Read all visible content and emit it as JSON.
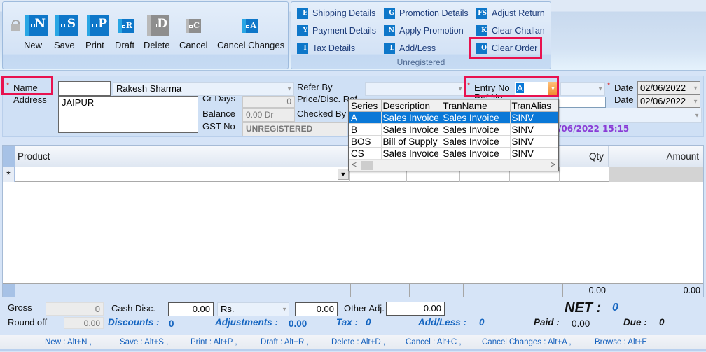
{
  "toolbar": {
    "main_buttons": [
      {
        "label": "New",
        "glyph": "N",
        "enabled": true
      },
      {
        "label": "Save",
        "glyph": "S",
        "enabled": true
      },
      {
        "label": "Print",
        "glyph": "P",
        "enabled": true
      },
      {
        "label": "Draft",
        "glyph": "R",
        "enabled": true
      },
      {
        "label": "Delete",
        "glyph": "D",
        "enabled": false
      },
      {
        "label": "Cancel",
        "glyph": "C",
        "enabled": false
      },
      {
        "label": "Cancel Changes",
        "glyph": "A",
        "enabled": true
      }
    ],
    "options_group": {
      "label": "Unregistered",
      "buttons": [
        {
          "label": "Shipping Details",
          "glyph": "E"
        },
        {
          "label": "Payment Details",
          "glyph": "Y"
        },
        {
          "label": "Tax Details",
          "glyph": "T"
        },
        {
          "label": "Promotion Details",
          "glyph": "G"
        },
        {
          "label": "Apply Promotion",
          "glyph": "N"
        },
        {
          "label": "Add/Less",
          "glyph": "L"
        },
        {
          "label": "Adjust Return",
          "glyph": "FS"
        },
        {
          "label": "Clear Challan",
          "glyph": "K"
        },
        {
          "label": "Clear Order",
          "glyph": "O"
        }
      ]
    }
  },
  "header": {
    "name_label": "Name",
    "name_code": "",
    "name_value": "Rakesh Sharma",
    "address_label": "Address",
    "address_value": "JAIPUR",
    "cr_days_label": "Cr Days",
    "cr_days_value": "0",
    "balance_label": "Balance",
    "balance_value": "0.00 Dr",
    "gst_label": "GST No",
    "gst_value": "UNREGISTERED",
    "refer_by_label": "Refer By",
    "refer_by_value": "",
    "price_disc_label": "Price/Disc. Ref",
    "checked_by_label": "Checked By",
    "entry_no_label": "Entry No",
    "entry_no_value": "A",
    "ref_no_label": "Ref No",
    "date_label": "Date",
    "date_value": "02/06/2022",
    "date2_label": "Date",
    "date2_value": "02/06/2022",
    "timestamp": "/06/2022 15:15"
  },
  "series_dropdown": {
    "columns": [
      "Series",
      "Description",
      "TranName",
      "TranAlias"
    ],
    "rows": [
      [
        "A",
        "Sales Invoice",
        "Sales Invoice",
        "SINV"
      ],
      [
        "B",
        "Sales Invoice",
        "Sales Invoice",
        "SINV"
      ],
      [
        "BOS",
        "Bill of Supply",
        "Sales Invoice",
        "SINV"
      ],
      [
        "CS",
        "Sales Invoice",
        "Sales Invoice",
        "SINV"
      ]
    ],
    "selected_index": 0
  },
  "grid": {
    "columns": {
      "product": "Product",
      "qty": "Qty",
      "amount": "Amount"
    },
    "new_row_marker": "*",
    "totals": {
      "qty": "0.00",
      "amount": "0.00"
    }
  },
  "totals": {
    "gross_label": "Gross",
    "gross_value": "0",
    "round_off_label": "Round off",
    "round_off_value": "0.00",
    "cash_disc_label": "Cash Disc.",
    "cash_disc_value": "0.00",
    "cash_disc_unit": "Rs.",
    "cash_disc_amount": "0.00",
    "other_adj_label": "Other Adj.",
    "other_adj_value": "0.00",
    "net_label": "NET :",
    "net_value": "0",
    "discounts_label": "Discounts :",
    "discounts_value": "0",
    "adjustments_label": "Adjustments :",
    "adjustments_value": "0.00",
    "tax_label": "Tax :",
    "tax_value": "0",
    "addless_label": "Add/Less :",
    "addless_value": "0",
    "paid_label": "Paid :",
    "paid_value": "0.00",
    "due_label": "Due :",
    "due_value": "0"
  },
  "shortcuts": [
    "New : Alt+N ,",
    "Save : Alt+S ,",
    "Print : Alt+P ,",
    "Draft : Alt+R ,",
    "Delete : Alt+D ,",
    "Cancel : Alt+C ,",
    "Cancel Changes : Alt+A ,",
    "Browse : Alt+E"
  ]
}
